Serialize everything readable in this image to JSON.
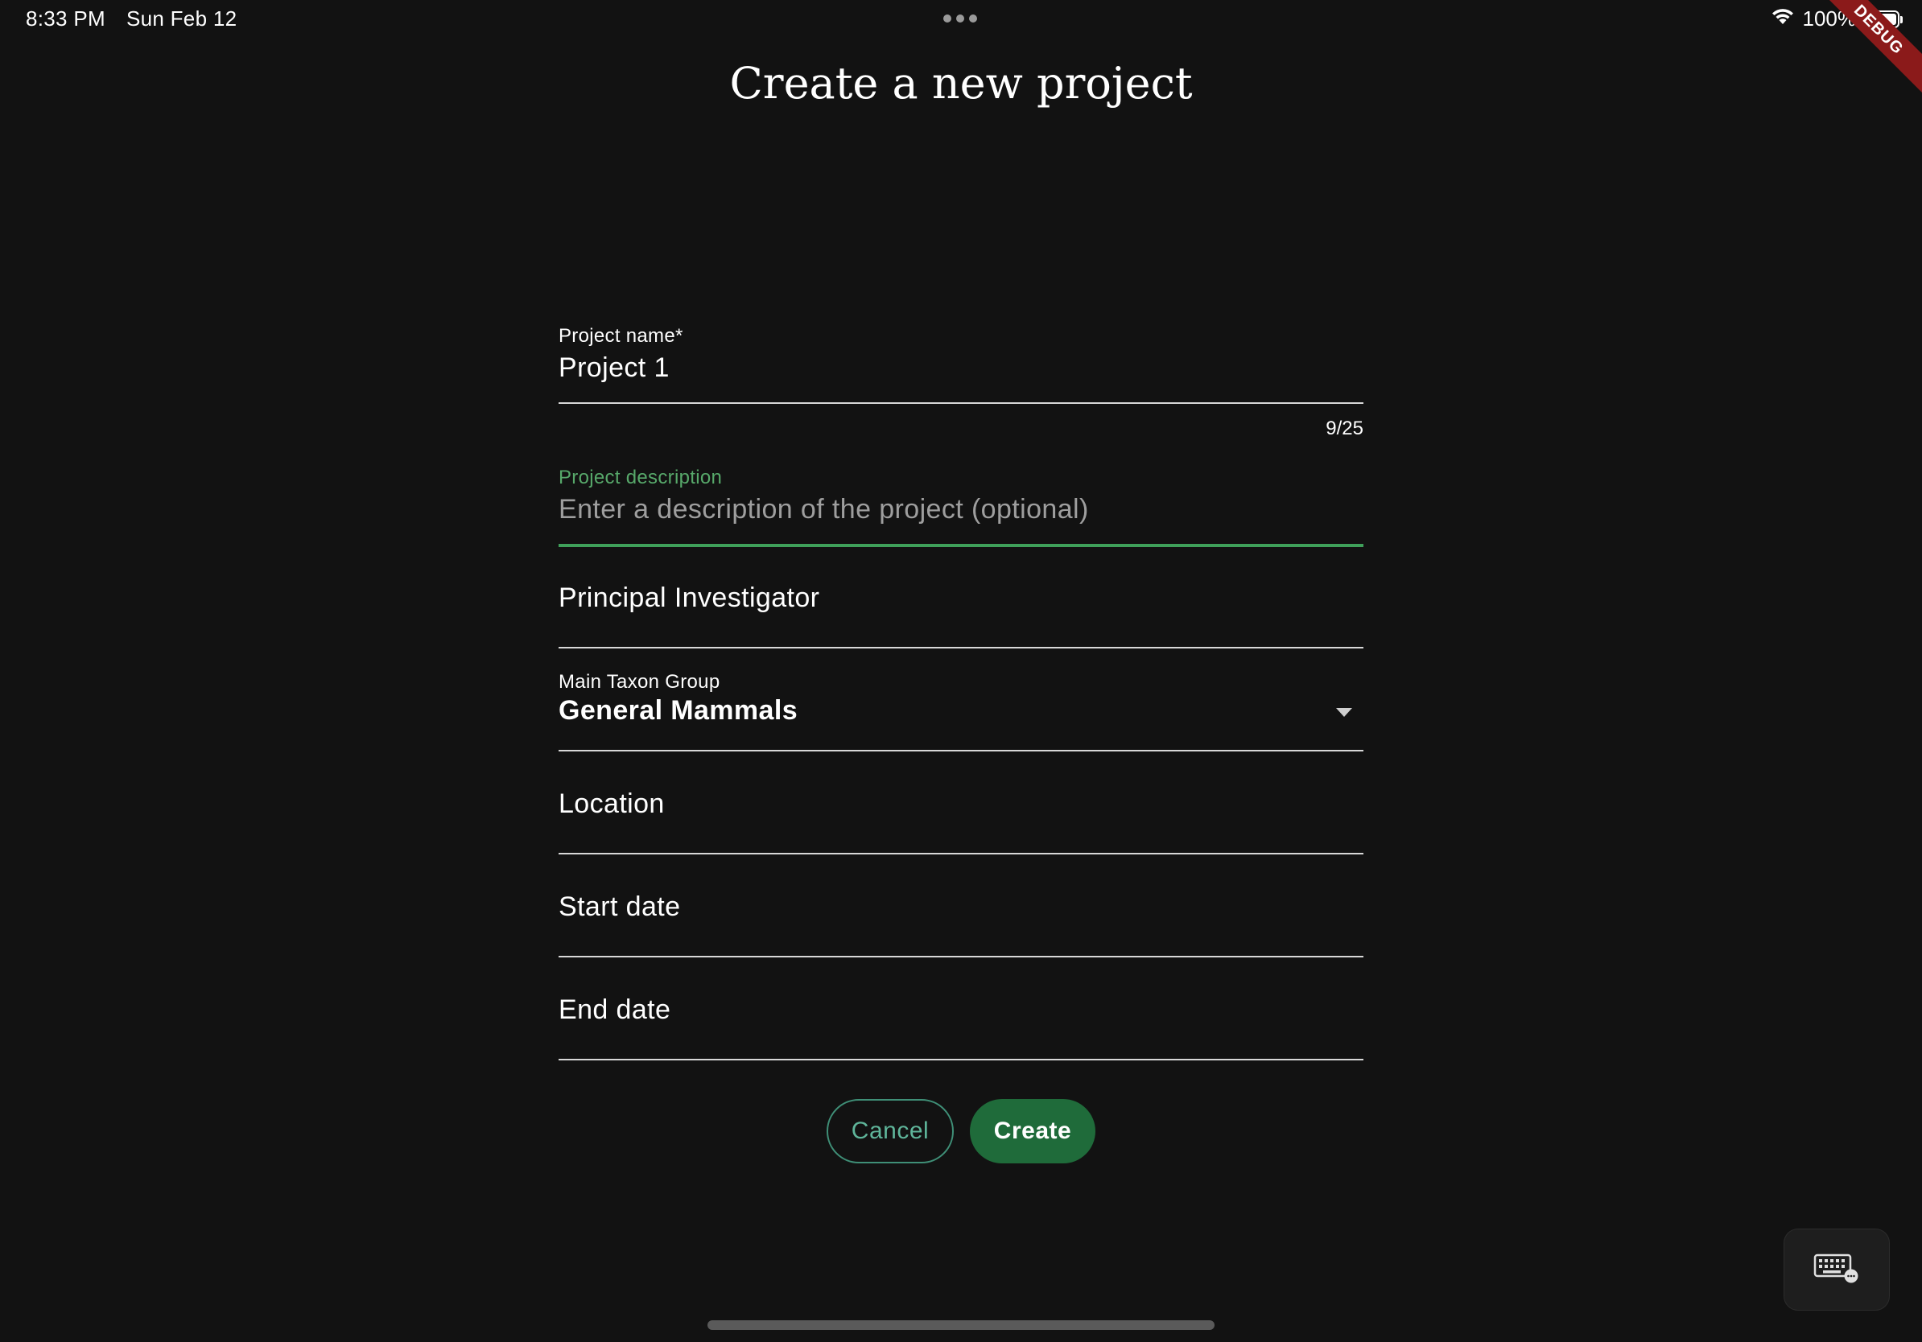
{
  "status_bar": {
    "time": "8:33 PM",
    "date": "Sun Feb 12",
    "battery": "100%"
  },
  "debug_banner": "DEBUG",
  "title": "Create a new project",
  "form": {
    "project_name": {
      "label": "Project name*",
      "value": "Project 1",
      "counter": "9/25"
    },
    "project_description": {
      "label": "Project description",
      "placeholder": "Enter a description of the project (optional)"
    },
    "principal_investigator": {
      "label": "Principal Investigator"
    },
    "main_taxon_group": {
      "label": "Main Taxon Group",
      "value": "General Mammals"
    },
    "location": {
      "label": "Location"
    },
    "start_date": {
      "label": "Start date"
    },
    "end_date": {
      "label": "End date"
    }
  },
  "buttons": {
    "cancel": "Cancel",
    "create": "Create"
  },
  "colors": {
    "background": "#121212",
    "accent_green": "#57a86a",
    "create_button": "#1f6b3a",
    "cancel_outline": "#3f8f77"
  },
  "icons": {
    "wifi": "wifi-icon",
    "battery": "battery-icon",
    "dropdown": "chevron-down-icon",
    "keyboard": "keyboard-icon"
  }
}
